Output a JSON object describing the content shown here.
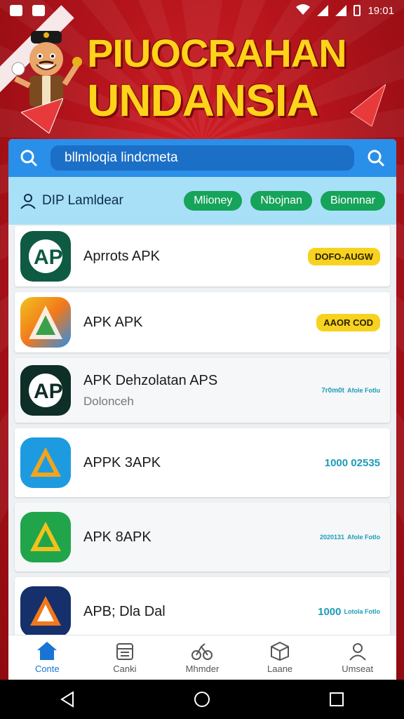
{
  "status_bar": {
    "time": "19:01"
  },
  "banner": {
    "title_line1": "PIUOCRAHAN",
    "title_line2": "UNDANSIA"
  },
  "search": {
    "value": "bllmloqia lindcmeta"
  },
  "filter": {
    "user_label": "DIP Lamldear",
    "chips": [
      "Mlioney",
      "Nbojnan",
      "Bionnnar"
    ]
  },
  "apps": [
    {
      "name": "Aprrots APK",
      "sub": "",
      "badge": "DOFO-AUGW",
      "badge_style": "yellow",
      "icon_color": "#0f5a43"
    },
    {
      "name": "APK APK",
      "sub": "",
      "badge": "AAOR COD",
      "badge_style": "yellow",
      "icon_color": "#f2a51c"
    },
    {
      "name": "APK Dehzolatan APS",
      "sub": "Dolonceh",
      "badge": "7r0m0t",
      "badge_extra": "Afole Fotlu",
      "badge_style": "text",
      "icon_color": "#0e2e28"
    },
    {
      "name": "APPK 3APK",
      "sub": "",
      "badge": "1000 02535",
      "badge_style": "text",
      "icon_color": "#1e9be0"
    },
    {
      "name": "APK 8APK",
      "sub": "",
      "badge": "2020131",
      "badge_extra": "Afole Fotlo",
      "badge_style": "text",
      "icon_color": "#20a54a"
    },
    {
      "name": "APB; Dla Dal",
      "sub": "",
      "badge": "1000",
      "badge_extra": "Lotola Fotlo",
      "badge_style": "text",
      "icon_color": "#15306a"
    }
  ],
  "bottom_nav": {
    "items": [
      {
        "label": "Conte",
        "icon": "home-icon",
        "active": true
      },
      {
        "label": "Canki",
        "icon": "calendar-icon",
        "active": false
      },
      {
        "label": "Mhmder",
        "icon": "bicycle-icon",
        "active": false
      },
      {
        "label": "Laane",
        "icon": "cube-icon",
        "active": false
      },
      {
        "label": "Umseat",
        "icon": "user-icon",
        "active": false
      }
    ]
  },
  "colors": {
    "banner_bg": "#b3121a",
    "title_yellow": "#ffd319",
    "search_blue": "#2a8fe8",
    "filter_bg": "#a8e0f7",
    "chip_green": "#16a35a",
    "active_nav": "#1a74d6"
  }
}
